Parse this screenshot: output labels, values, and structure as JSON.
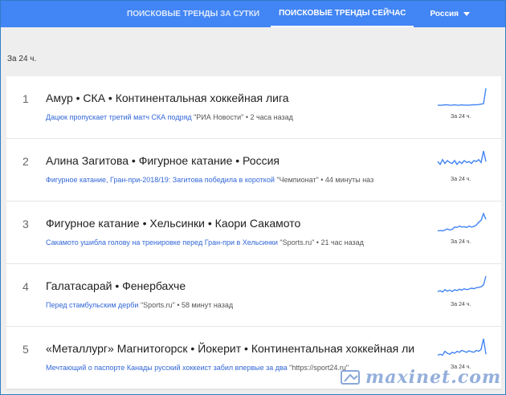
{
  "tabs": {
    "daily": "ПОИСКОВЫЕ ТРЕНДЫ ЗА СУТКИ",
    "now": "ПОИСКОВЫЕ ТРЕНДЫ СЕЙЧАС",
    "country": "Россия"
  },
  "period_label": "За 24 ч.",
  "trends": [
    {
      "rank": "1",
      "title": "Амур • СКА • Континентальная хоккейная лига",
      "headline": "Дацюк пропускает третий матч СКА подряд",
      "meta": " \"РИА Новости\" • 2 часа назад",
      "spark_label": "За 24 ч.",
      "spark": [
        0.12,
        0.12,
        0.12,
        0.15,
        0.14,
        0.12,
        0.13,
        0.14,
        0.13,
        0.12,
        0.14,
        0.13,
        0.13,
        0.12,
        0.14,
        0.15,
        0.14,
        0.16,
        0.18,
        0.2,
        1.0
      ]
    },
    {
      "rank": "2",
      "title": "Алина Загитова • Фигурное катание • Россия",
      "headline": "Фигурное катание, Гран-при-2018/19: Загитова победила в короткой",
      "meta": " \"Чемпионат\" • 44 минуты наз",
      "spark_label": "За 24 ч.",
      "spark": [
        0.45,
        0.3,
        0.55,
        0.35,
        0.5,
        0.4,
        0.35,
        0.5,
        0.3,
        0.45,
        0.35,
        0.5,
        0.4,
        0.45,
        0.35,
        0.5,
        0.45,
        0.55,
        0.4,
        1.0,
        0.45
      ]
    },
    {
      "rank": "3",
      "title": "Фигурное катание • Хельсинки • Каори Сакамото",
      "headline": "Сакамото ушибла голову на тренировке перед Гран-при в Хельсинки",
      "meta": " \"Sports.ru\" • 21 час назад",
      "spark_label": "За 24 ч.",
      "spark": [
        0.1,
        0.12,
        0.1,
        0.15,
        0.2,
        0.15,
        0.18,
        0.3,
        0.28,
        0.35,
        0.3,
        0.32,
        0.28,
        0.35,
        0.3,
        0.33,
        0.4,
        0.55,
        0.65,
        1.0,
        0.7
      ]
    },
    {
      "rank": "4",
      "title": "Галатасарай • Фенербахче",
      "headline": "Перед стамбульским дерби",
      "meta": " \"Sports.ru\" • 58 минут назад",
      "spark_label": "За 24 ч.",
      "spark": [
        0.2,
        0.25,
        0.18,
        0.3,
        0.22,
        0.28,
        0.2,
        0.3,
        0.25,
        0.32,
        0.28,
        0.35,
        0.3,
        0.33,
        0.38,
        0.35,
        0.4,
        0.42,
        0.45,
        0.55,
        1.0
      ]
    },
    {
      "rank": "5",
      "title": "«Металлург» Магнитогорск • Йокерит • Континентальная хоккейная лига",
      "headline": "Мечтающий о паспорте Канады русский хоккеист забил впервые за два",
      "meta": " \"https://sport24.ru\"",
      "spark_label": "За 24 ч.",
      "spark": [
        0.15,
        0.2,
        0.15,
        0.35,
        0.25,
        0.2,
        0.3,
        0.25,
        0.35,
        0.3,
        0.4,
        0.35,
        0.3,
        0.38,
        0.33,
        0.3,
        0.4,
        0.35,
        0.45,
        1.0,
        0.2
      ]
    }
  ],
  "watermark": "maxinet.com",
  "colors": {
    "header": "#4285f4",
    "link": "#3367d6",
    "spark": "#4285f4"
  }
}
